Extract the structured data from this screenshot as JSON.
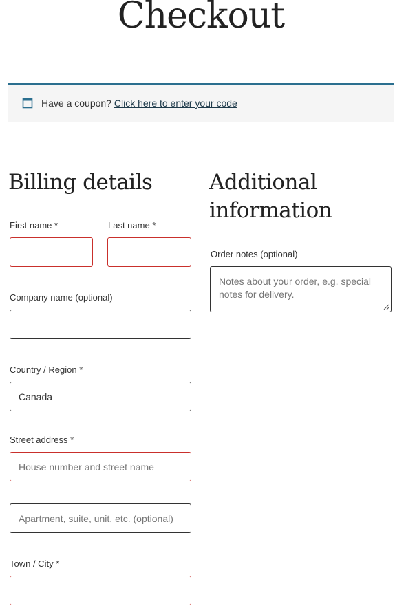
{
  "page": {
    "title": "Checkout"
  },
  "coupon": {
    "icon": "window-icon",
    "prompt": "Have a coupon?",
    "link": "Click here to enter your code",
    "accent": "#2b6f8f"
  },
  "billing": {
    "heading": "Billing details",
    "first_name": {
      "label": "First name",
      "required": "*",
      "value": ""
    },
    "last_name": {
      "label": "Last name",
      "required": "*",
      "value": ""
    },
    "company": {
      "label": "Company name (optional)",
      "value": ""
    },
    "country": {
      "label": "Country / Region",
      "required": "*",
      "value": "Canada"
    },
    "street": {
      "label": "Street address",
      "required": "*",
      "placeholder1": "House number and street name",
      "placeholder2": "Apartment, suite, unit, etc. (optional)"
    },
    "city": {
      "label": "Town / City",
      "required": "*",
      "value": ""
    }
  },
  "additional": {
    "heading_line1": "Additional",
    "heading_line2": "information",
    "notes_label": "Order notes (optional)",
    "notes_placeholder_line1": "Notes about your order, e.g. special",
    "notes_placeholder_line2": "notes for delivery."
  },
  "colors": {
    "error_border": "#c9302c",
    "text": "#1e1e1e",
    "notice_bg": "#f5f5f5"
  }
}
